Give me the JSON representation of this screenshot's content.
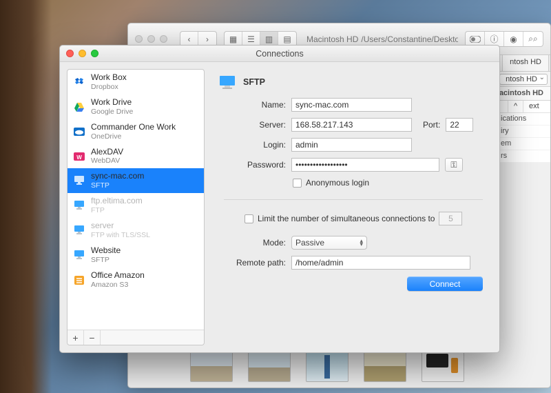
{
  "finder": {
    "path_prefix": "Macintosh HD",
    "path": "/Users/Constantine/Desktop/www/MacEltima/#im",
    "tab": "ntosh HD",
    "drop": "ntosh HD",
    "breadcrumb": "Macintosh HD",
    "col_sort": "^",
    "col_ext": "ext",
    "rows": [
      "ications",
      "iry",
      "em",
      "rs"
    ]
  },
  "modal": {
    "title": "Connections",
    "sidebar": {
      "items": [
        {
          "title": "Work Box",
          "sub": "Dropbox",
          "icon": "dropbox",
          "state": "normal"
        },
        {
          "title": "Work Drive",
          "sub": "Google Drive",
          "icon": "gdrive",
          "state": "normal"
        },
        {
          "title": "Commander One Work",
          "sub": "OneDrive",
          "icon": "onedrive",
          "state": "normal"
        },
        {
          "title": "AlexDAV",
          "sub": "WebDAV",
          "icon": "webdav",
          "state": "normal"
        },
        {
          "title": "sync-mac.com",
          "sub": "SFTP",
          "icon": "sftp",
          "state": "selected"
        },
        {
          "title": "ftp.eltima.com",
          "sub": "FTP",
          "icon": "ftp",
          "state": "faded"
        },
        {
          "title": "server",
          "sub": "FTP with TLS/SSL",
          "icon": "ftp",
          "state": "faded"
        },
        {
          "title": "Website",
          "sub": "SFTP",
          "icon": "sftp",
          "state": "normal"
        },
        {
          "title": "Office Amazon",
          "sub": "Amazon S3",
          "icon": "s3",
          "state": "normal"
        }
      ]
    },
    "form": {
      "protocol": "SFTP",
      "labels": {
        "name": "Name:",
        "server": "Server:",
        "port": "Port:",
        "login": "Login:",
        "password": "Password:",
        "anonymous": "Anonymous login",
        "limit": "Limit the number of simultaneous connections to",
        "mode": "Mode:",
        "remote_path": "Remote path:"
      },
      "values": {
        "name": "sync-mac.com",
        "server": "168.58.217.143",
        "port": "22",
        "login": "admin",
        "password": "••••••••••••••••••",
        "anonymous": false,
        "limit_enabled": false,
        "limit_value": "5",
        "mode": "Passive",
        "remote_path": "/home/admin"
      },
      "connect": "Connect"
    }
  }
}
